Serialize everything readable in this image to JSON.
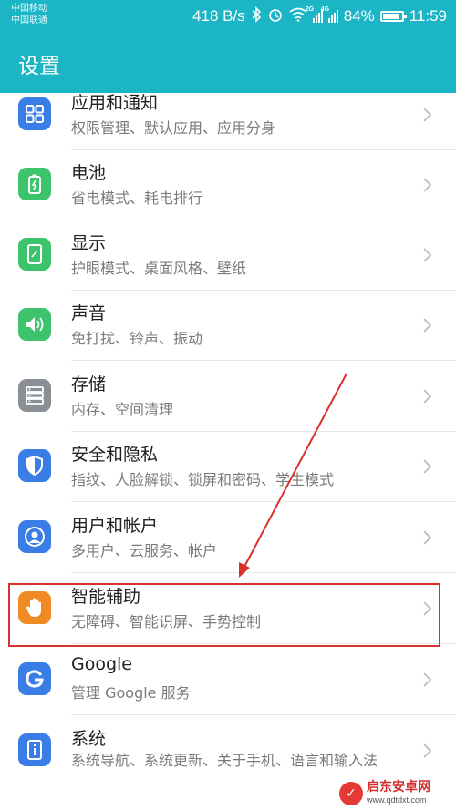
{
  "status_bar": {
    "carrier_1": "中国移动",
    "carrier_2": "中国联通",
    "speed": "418 B/s",
    "signal_1_tag": "2G",
    "signal_2_tag": "4G",
    "battery": "84%",
    "battery_level": 0.84,
    "time": "11:59"
  },
  "header": {
    "title": "设置"
  },
  "items": [
    {
      "title": "应用和通知",
      "subtitle": "权限管理、默认应用、应用分身",
      "icon": "apps-grid-icon",
      "color": "#3b7de6"
    },
    {
      "title": "电池",
      "subtitle": "省电模式、耗电排行",
      "icon": "battery-icon",
      "color": "#3cc36b"
    },
    {
      "title": "显示",
      "subtitle": "护眼模式、桌面风格、壁纸",
      "icon": "display-icon",
      "color": "#3cc36b"
    },
    {
      "title": "声音",
      "subtitle": "免打扰、铃声、振动",
      "icon": "speaker-icon",
      "color": "#3cc36b"
    },
    {
      "title": "存储",
      "subtitle": "内存、空间清理",
      "icon": "storage-icon",
      "color": "#8a8f96"
    },
    {
      "title": "安全和隐私",
      "subtitle": "指纹、人脸解锁、锁屏和密码、学生模式",
      "icon": "shield-icon",
      "color": "#3b7de6"
    },
    {
      "title": "用户和帐户",
      "subtitle": "多用户、云服务、帐户",
      "icon": "user-icon",
      "color": "#3b7de6"
    },
    {
      "title": "智能辅助",
      "subtitle": "无障碍、智能识屏、手势控制",
      "icon": "hand-icon",
      "color": "#f08a24"
    },
    {
      "title": "Google",
      "subtitle": "管理 Google 服务",
      "icon": "google-icon",
      "color": "#3b7de6"
    },
    {
      "title": "系统",
      "subtitle": "系统导航、系统更新、关于手机、语言和输入法",
      "icon": "system-info-icon",
      "color": "#3b7de6"
    }
  ],
  "watermark": {
    "name": "启东安卓网",
    "url": "www.qdtdxt.com"
  },
  "annotation": {
    "color": "#d7312f"
  }
}
